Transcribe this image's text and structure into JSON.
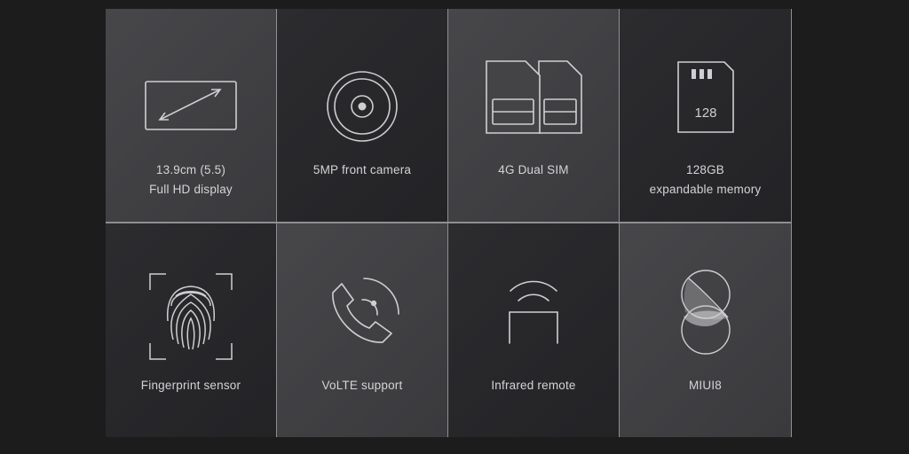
{
  "features": [
    {
      "icon": "display-diagonal-icon",
      "lines": [
        "13.9cm (5.5)",
        "Full HD display"
      ]
    },
    {
      "icon": "camera-lens-icon",
      "lines": [
        "5MP front camera"
      ]
    },
    {
      "icon": "dual-sim-icon",
      "lines": [
        "4G Dual SIM"
      ]
    },
    {
      "icon": "memory-card-icon",
      "lines": [
        "128GB",
        "expandable memory"
      ],
      "card_label": "128"
    },
    {
      "icon": "fingerprint-icon",
      "lines": [
        "Fingerprint sensor"
      ]
    },
    {
      "icon": "volte-phone-icon",
      "lines": [
        "VoLTE support"
      ]
    },
    {
      "icon": "infrared-icon",
      "lines": [
        "Infrared remote"
      ]
    },
    {
      "icon": "miui-logo-icon",
      "lines": [
        "MIUI8"
      ]
    }
  ],
  "colors": {
    "page_background": "#1c1c1c",
    "tile_light": "#434346",
    "tile_dark": "#28282b",
    "divider": "#8f8f91",
    "icon_stroke": "#cfcfd1",
    "text": "#d4d4d6"
  }
}
